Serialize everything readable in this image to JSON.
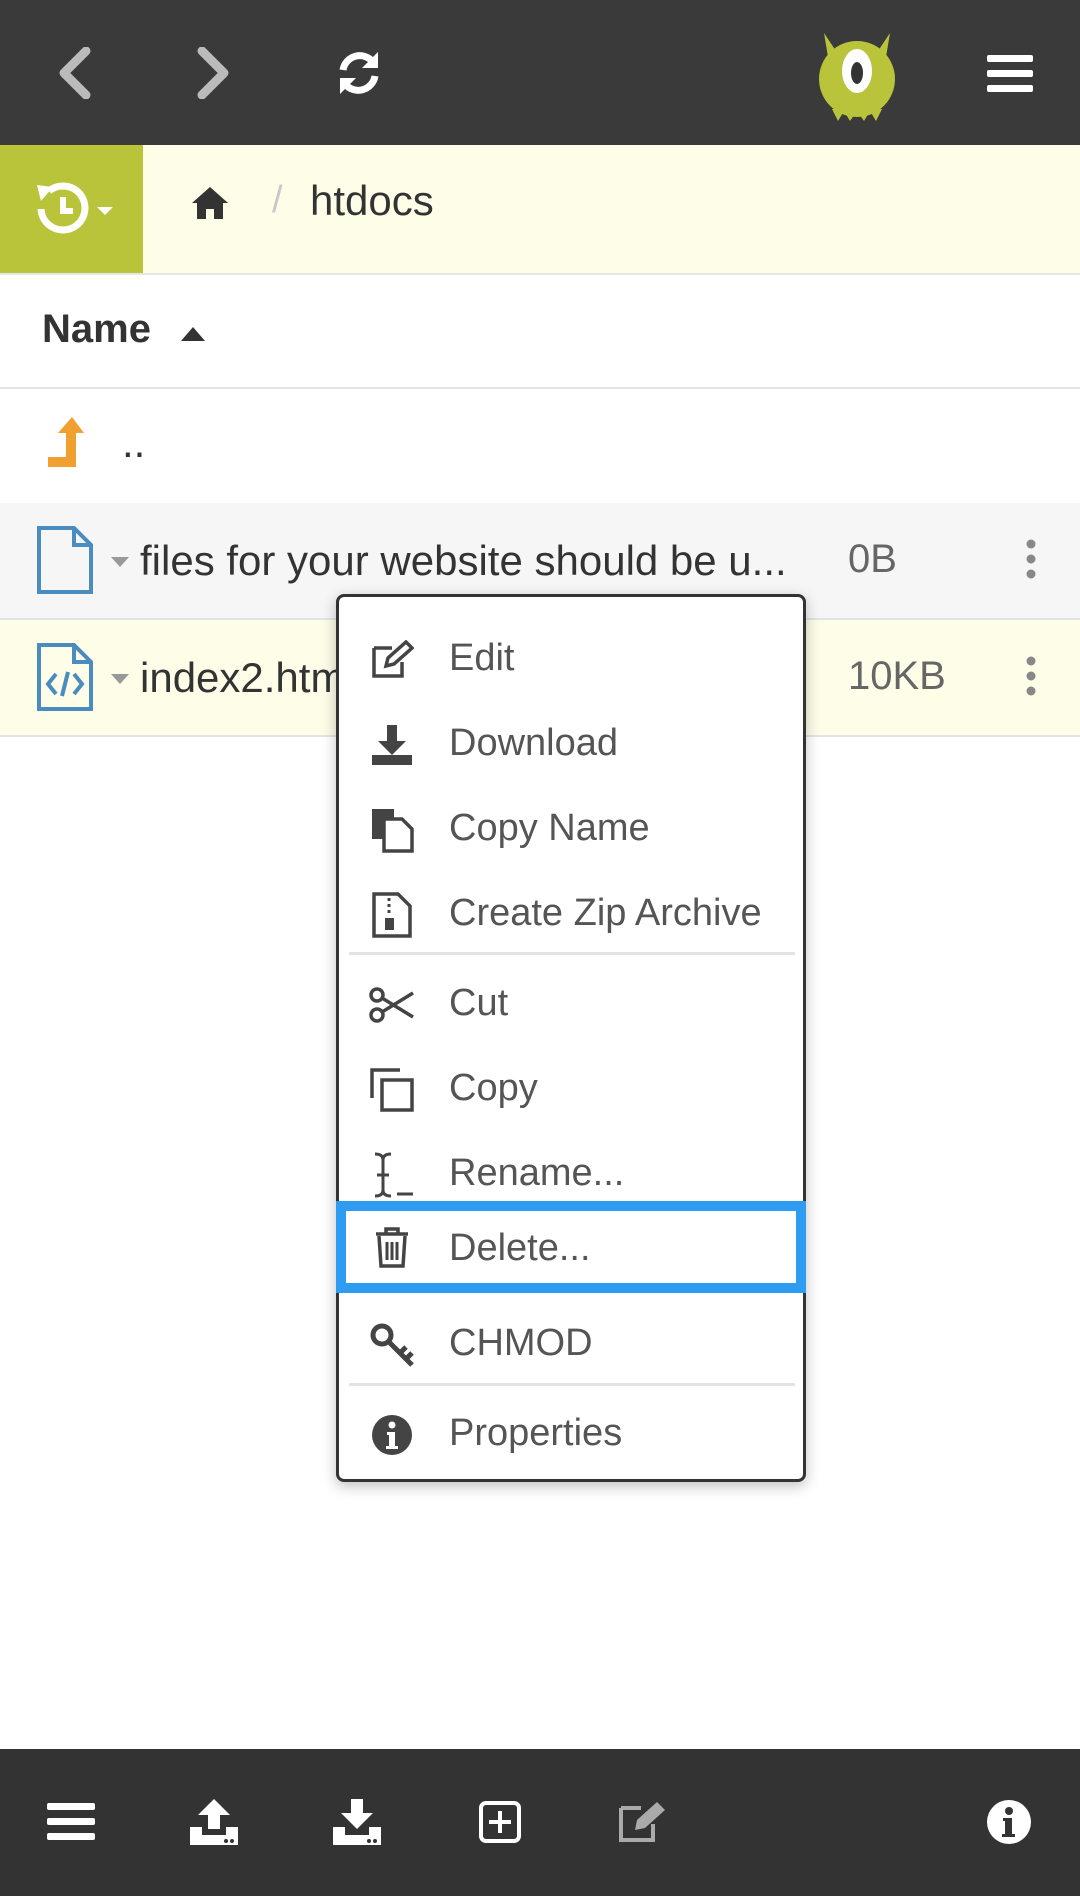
{
  "colors": {
    "topbar": "#3a3a3a",
    "accent_green": "#b9c43a",
    "breadcrumb_bg": "#fdfde8",
    "selection_outline": "#2e9cf0",
    "file_icon": "#4a8bc0",
    "parent_arrow": "#f0a030"
  },
  "topbar": {
    "back_icon": "chevron-left-icon",
    "forward_icon": "chevron-right-icon",
    "refresh_icon": "refresh-icon",
    "logo_icon": "monster-logo-icon",
    "menu_icon": "hamburger-icon"
  },
  "breadcrumb": {
    "history_icon": "history-icon",
    "home_icon": "home-icon",
    "separator": "/",
    "current_dir": "htdocs"
  },
  "file_list": {
    "column_name": "Name",
    "sort_direction": "ascending",
    "parent_label": "..",
    "rows": [
      {
        "name": "files for your website should be u...",
        "size": "0B",
        "icon": "file-icon"
      },
      {
        "name": "index2.htm",
        "size": "10KB",
        "icon": "code-file-icon"
      }
    ]
  },
  "context_menu": {
    "items": [
      {
        "label": "Edit",
        "icon": "edit-icon"
      },
      {
        "label": "Download",
        "icon": "download-icon"
      },
      {
        "label": "Copy Name",
        "icon": "copy-name-icon"
      },
      {
        "label": "Create Zip Archive",
        "icon": "zip-file-icon"
      },
      {
        "label": "Cut",
        "icon": "scissors-icon"
      },
      {
        "label": "Copy",
        "icon": "copy-icon"
      },
      {
        "label": "Rename...",
        "icon": "rename-cursor-icon"
      },
      {
        "label": "Delete...",
        "icon": "trash-icon",
        "selected": true
      },
      {
        "label": "CHMOD",
        "icon": "key-icon"
      },
      {
        "label": "Properties",
        "icon": "info-icon"
      }
    ]
  },
  "bottombar": {
    "icons": [
      "menu-icon",
      "upload-icon",
      "download-icon",
      "new-file-icon",
      "edit-icon",
      "info-icon"
    ]
  }
}
